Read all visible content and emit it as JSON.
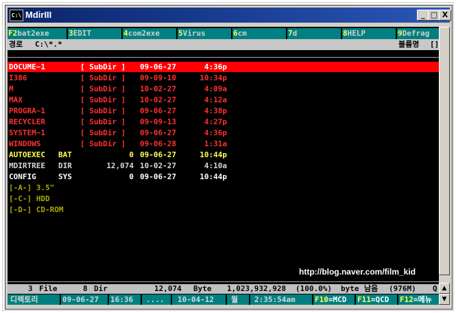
{
  "window": {
    "title": "MdirIII",
    "icon": "C:\\",
    "buttons": {
      "minimize": "_",
      "maximize": "□",
      "close": "X"
    }
  },
  "fkeys": [
    {
      "key": "F2",
      "label": "bat2exe"
    },
    {
      "key": "3",
      "label": "EDIT"
    },
    {
      "key": "4",
      "label": "com2exe"
    },
    {
      "key": "5",
      "label": "Virus"
    },
    {
      "key": "6",
      "label": "cm"
    },
    {
      "key": "7",
      "label": "d"
    },
    {
      "key": "8",
      "label": "HELP"
    },
    {
      "key": "9",
      "label": "Defrag"
    }
  ],
  "path": {
    "label": "경로",
    "value": "C:\\*.*",
    "volume_label": "볼륨명",
    "volume_value": "[]"
  },
  "files": [
    {
      "name": "DOCUME~1",
      "ext": "",
      "size": "[ SubDir ]",
      "date": "09-06-27",
      "time": "4:36p",
      "type": "dir",
      "selected": true
    },
    {
      "name": "I386",
      "ext": "",
      "size": "[ SubDir ]",
      "date": "09-09-10",
      "time": "10:34p",
      "type": "dir"
    },
    {
      "name": "M",
      "ext": "",
      "size": "[ SubDir ]",
      "date": "10-02-27",
      "time": "4:09a",
      "type": "dir"
    },
    {
      "name": "MAX",
      "ext": "",
      "size": "[ SubDir ]",
      "date": "10-02-27",
      "time": "4:12a",
      "type": "dir"
    },
    {
      "name": "PROGRA~1",
      "ext": "",
      "size": "[ SubDir ]",
      "date": "09-06-27",
      "time": "4:38p",
      "type": "dir"
    },
    {
      "name": "RECYCLER",
      "ext": "",
      "size": "[ SubDir ]",
      "date": "09-09-13",
      "time": "4:27p",
      "type": "dir"
    },
    {
      "name": "SYSTEM~1",
      "ext": "",
      "size": "[ SubDir ]",
      "date": "09-06-27",
      "time": "4:36p",
      "type": "dir"
    },
    {
      "name": "WINDOWS",
      "ext": "",
      "size": "[ SubDir ]",
      "date": "09-06-28",
      "time": "1:31a",
      "type": "dir"
    },
    {
      "name": "AUTOEXEC",
      "ext": "BAT",
      "size": "0",
      "date": "09-06-27",
      "time": "10:44p",
      "type": "exec"
    },
    {
      "name": "MDIRTREE",
      "ext": "DIR",
      "size": "12,074",
      "date": "10-02-27",
      "time": "4:10a",
      "type": "file"
    },
    {
      "name": "CONFIG",
      "ext": "SYS",
      "size": "0",
      "date": "09-06-27",
      "time": "10:44p",
      "type": "sys"
    }
  ],
  "drives": [
    "[-A-] 3.5\"",
    "[-C-] HDD",
    "[-D-] CD-ROM"
  ],
  "watermark": "http://blog.naver.com/film_kid",
  "status": {
    "files_count": "3",
    "files_label": "File",
    "dirs_count": "8",
    "dirs_label": "Dir",
    "bytes": "12,074",
    "bytes_label": "Byte",
    "free": "1,023,932,928",
    "free_pct": "(100.0%)",
    "free_unit": "byte",
    "remaining_label": "남음",
    "remaining_value": "(976M)",
    "tail": "Q"
  },
  "bottom": {
    "tree_label": "디렉토리",
    "date1": "09-06-27",
    "time1": "16:36",
    "dots": "....",
    "date2": "10-04-12",
    "weekday": "월",
    "clock": "2:35:54am",
    "f10": {
      "key": "F10",
      "label": "=MCD"
    },
    "f11": {
      "key": "F11",
      "label": "=QCD"
    },
    "f12": {
      "key": "F12",
      "label": "=메뉴"
    }
  },
  "colors": {
    "titlebar": "#0a246a",
    "selected_row": "#ff0000",
    "dir_text": "#ff3030",
    "func_bar": "#008080",
    "console_bg": "#000000"
  }
}
